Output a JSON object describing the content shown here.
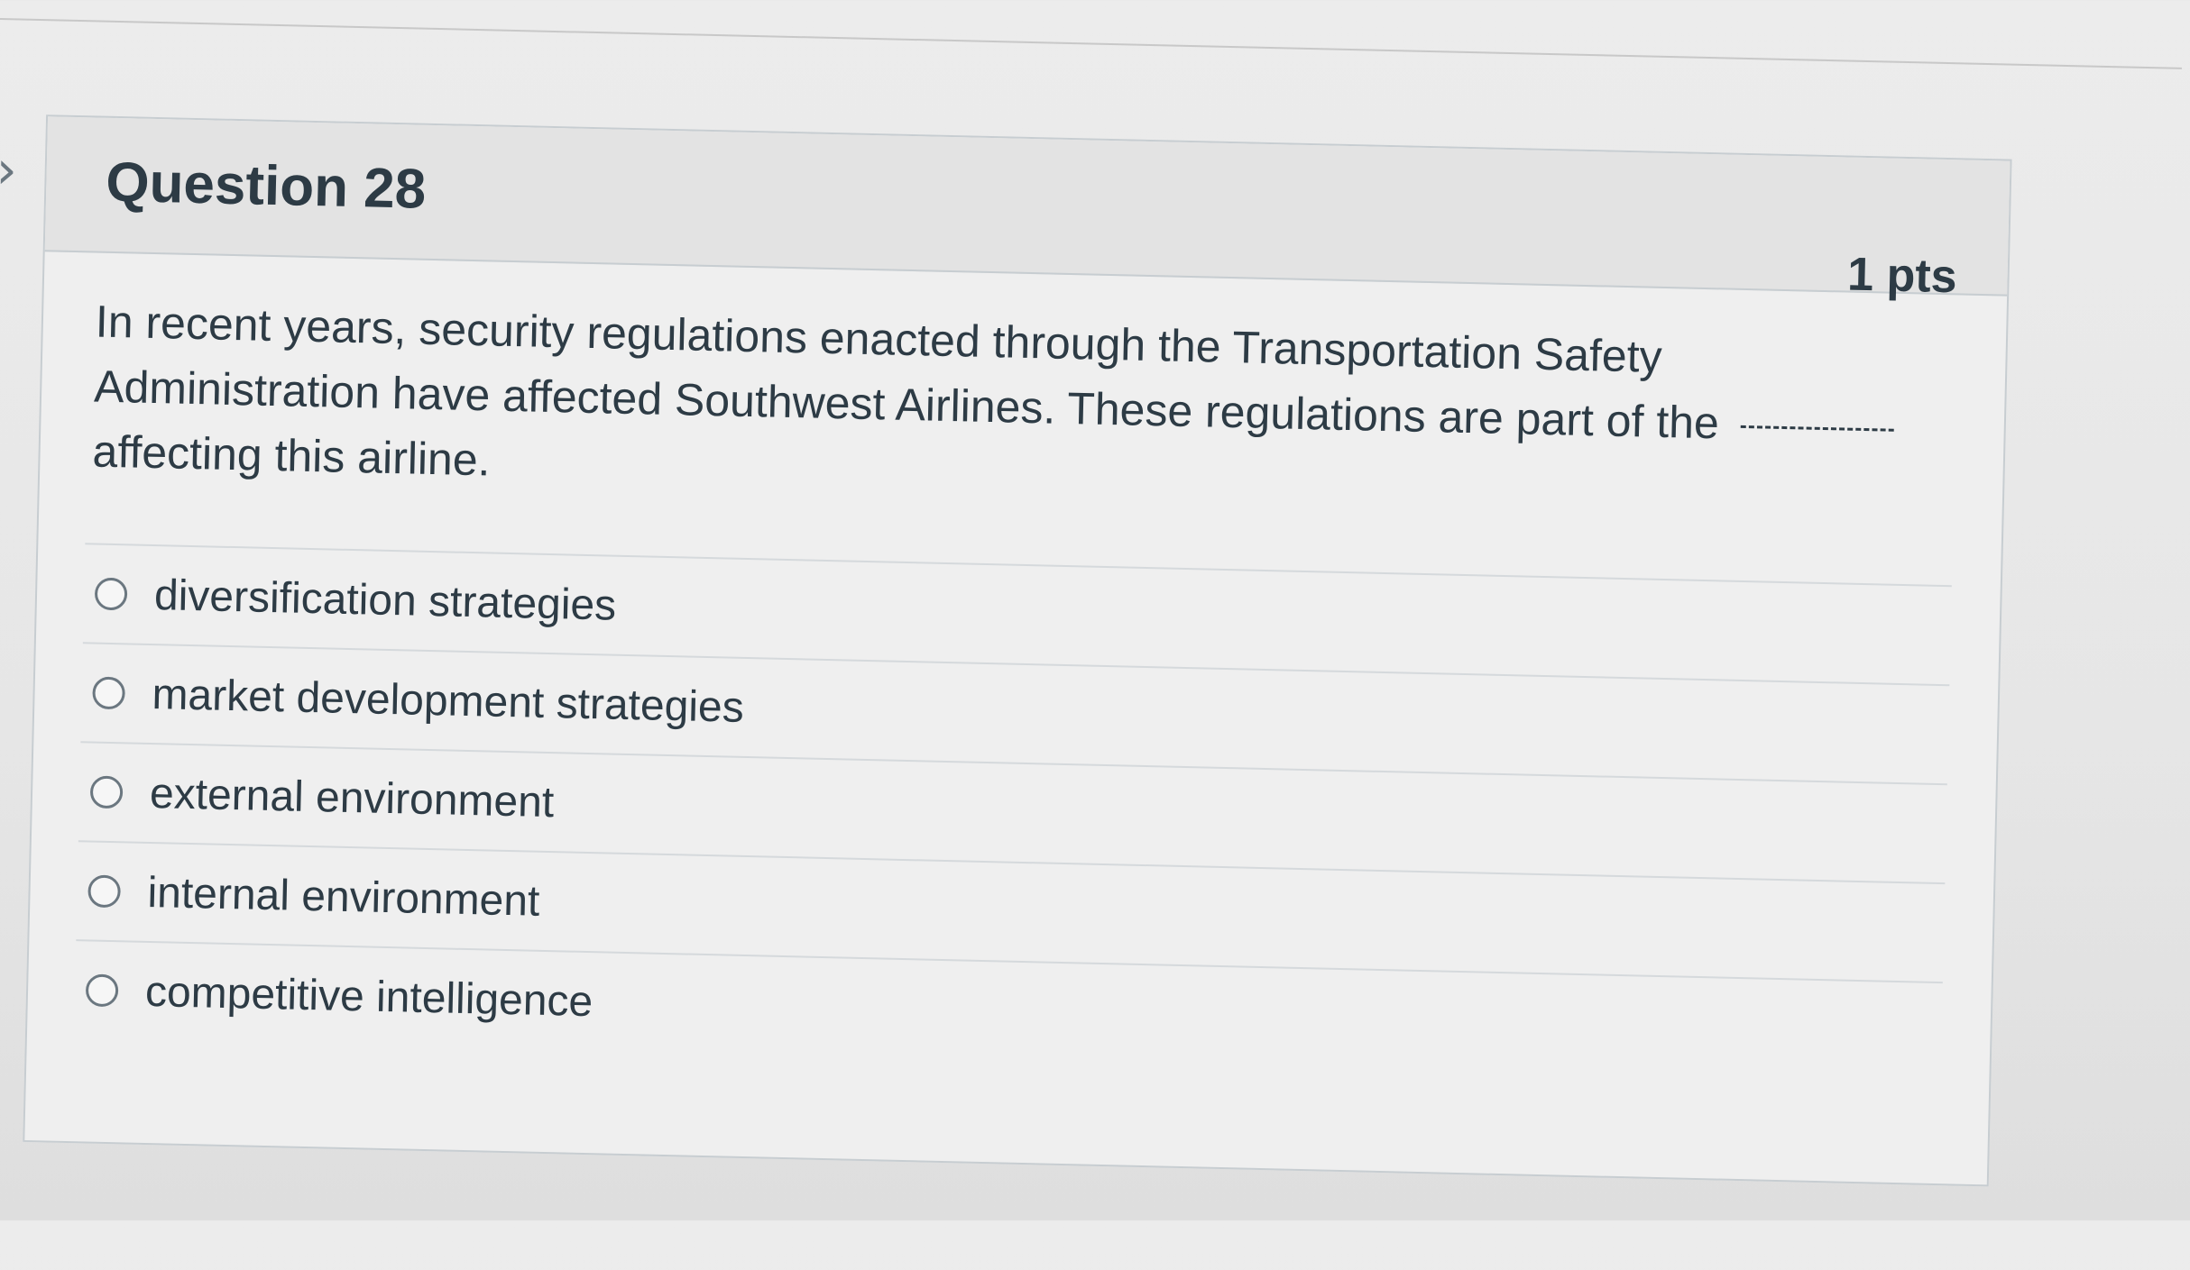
{
  "question": {
    "title": "Question 28",
    "points": "1 pts",
    "text_before_blank": "In recent years, security regulations enacted through the Transportation Safety Administration have affected Southwest Airlines. These regulations are part of the",
    "text_after_blank": "affecting this airline."
  },
  "answers": [
    {
      "label": "diversification strategies"
    },
    {
      "label": "market development strategies"
    },
    {
      "label": "external environment"
    },
    {
      "label": "internal environment"
    },
    {
      "label": "competitive intelligence"
    }
  ],
  "nav": {
    "icon": "chevron-right-icon"
  },
  "colors": {
    "text": "#2d3b45",
    "border": "#c7cdd1",
    "header_bg": "#e3e3e3",
    "body_bg": "#efefef"
  }
}
